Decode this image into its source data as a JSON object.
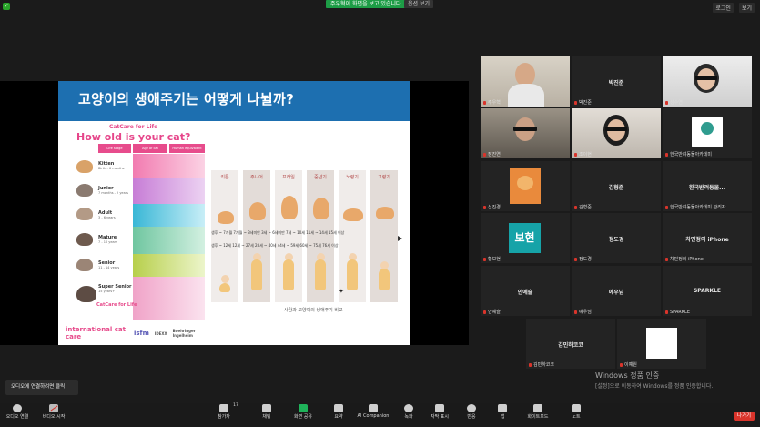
{
  "topbar": {
    "share_banner": "주우혁이 화면을 보고 있습니다",
    "view_options": "옵션 보기",
    "logout": "로그인",
    "view": "보기"
  },
  "slide": {
    "title": "고양이의 생애주기는 어떻게 나뉠까?",
    "poster": {
      "brand": "CatCare for Life",
      "question": "How old is your cat?",
      "col_stage": "Life stage",
      "col_cat": "Age of cat",
      "col_human": "Human equivalent age",
      "stages": [
        {
          "name": "Kitten",
          "range": "Birth - 6 months"
        },
        {
          "name": "Junior",
          "range": "7 months - 2 years"
        },
        {
          "name": "Adult",
          "range": "3 - 6 years"
        },
        {
          "name": "Mature",
          "range": "7 - 10 years"
        },
        {
          "name": "Senior",
          "range": "11 - 14 years"
        },
        {
          "name": "Super Senior",
          "range": "15 years+"
        }
      ],
      "footer_logo_1": "international cat care",
      "footer_logo_2": "isfm",
      "footer_logo_3": "IDEXX",
      "footer_logo_4": "Boehringer Ingelheim",
      "partner_label": "CatCare for Life"
    },
    "compare": {
      "heads": [
        "키튼",
        "주니어",
        "프라임",
        "중년기",
        "노령기",
        "고령기"
      ],
      "cat_ages": "생후 ~ 7개월   7개월 ~ 3세미만   3세 ~ 6세미만   7세 ~ 10세   11세 ~ 14세   15세 이상",
      "human_ages": "생후 ~ 12세   12세 ~ 27세   28세 ~ 40세   44세 ~ 59세   60세 ~ 75세   76세 이상",
      "caption": "사람과 고양이의 생애주기 비교"
    }
  },
  "gallery": [
    {
      "name": "",
      "label": "주우혁"
    },
    {
      "name": "박진준",
      "label": "박진준"
    },
    {
      "name": "",
      "label": "성수연"
    },
    {
      "name": "",
      "label": "장진연"
    },
    {
      "name": "",
      "label": "조이현"
    },
    {
      "name": "",
      "label": "한국반려동물아카데미"
    },
    {
      "name": "",
      "label": "신진경"
    },
    {
      "name": "김형준",
      "label": "김형준"
    },
    {
      "name": "한국반려동물...",
      "label": "한국반려동물아카데미 관리자"
    },
    {
      "name": "",
      "label": "황보현",
      "badge": "보현"
    },
    {
      "name": "정도경",
      "label": "정도경"
    },
    {
      "name": "차민정의 iPhone",
      "label": "차민정의 iPhone"
    },
    {
      "name": "안예슬",
      "label": "안예슬"
    },
    {
      "name": "예우님",
      "label": "예우님"
    },
    {
      "name": "SPARKLE",
      "label": "SPARKLE"
    },
    {
      "name": "김민하코코",
      "label": "김민하코코"
    },
    {
      "name": "",
      "label": "이예원"
    }
  ],
  "watermark": {
    "line1": "Windows 정품 인증",
    "line2": "[설정]으로 이동하여 Windows를 정품 인증합니다."
  },
  "tooltip": "오디오에 연결하려면 클릭",
  "toolbar": {
    "audio": "오디오 연결",
    "video": "비디오 시작",
    "participants": "참가자",
    "participants_count": "17",
    "chat": "채팅",
    "share": "화면 공유",
    "summary": "요약",
    "ai": "AI Companion",
    "record": "녹화",
    "captions": "자막 표시",
    "reactions": "반응",
    "apps": "앱",
    "whiteboard": "화이트보드",
    "notes": "노트",
    "leave": "나가기"
  }
}
